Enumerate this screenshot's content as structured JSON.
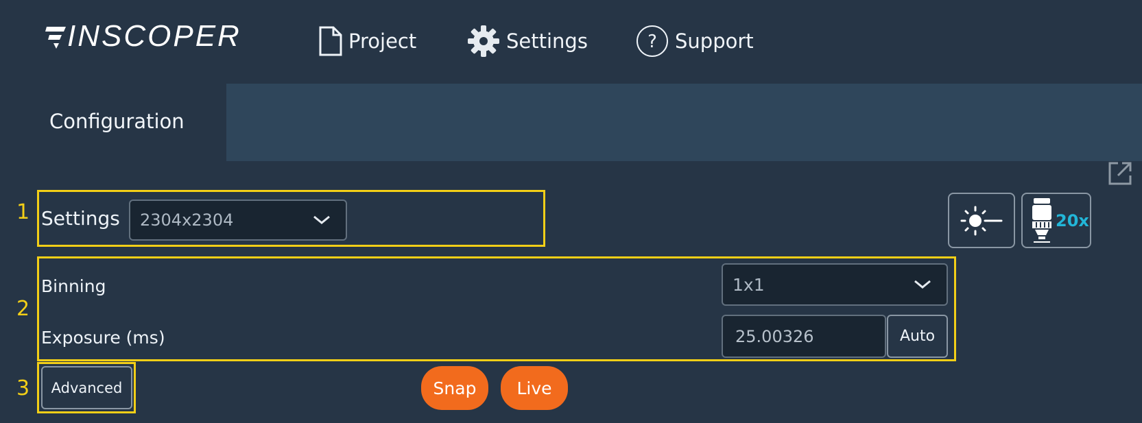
{
  "app": {
    "logo": "INSCOPER"
  },
  "nav": {
    "project": "Project",
    "settings": "Settings",
    "support": "Support"
  },
  "tabs": {
    "active": "Configuration"
  },
  "annotations": {
    "n1": "1",
    "n2": "2",
    "n3": "3"
  },
  "settings_row": {
    "label": "Settings",
    "value": "2304x2304"
  },
  "binning": {
    "label": "Binning",
    "value": "1x1"
  },
  "exposure": {
    "label": "Exposure (ms)",
    "value": "25.00326",
    "auto_label": "Auto"
  },
  "advanced": {
    "label": "Advanced"
  },
  "actions": {
    "snap": "Snap",
    "live": "Live"
  },
  "objective": {
    "magnification": "20x"
  },
  "colors": {
    "background": "#263546",
    "tab_strip": "#2f465b",
    "accent_orange": "#f26b1d",
    "highlight_yellow": "#f3cf17",
    "objective_cyan": "#22b6d8"
  }
}
